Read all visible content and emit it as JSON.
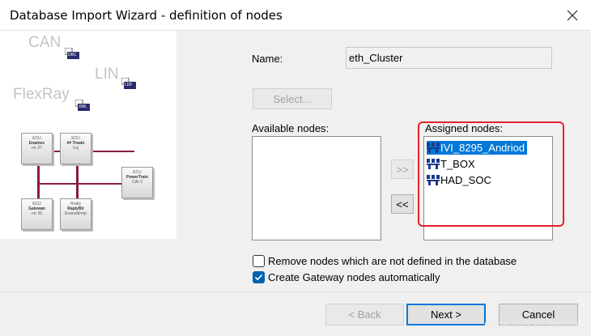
{
  "window": {
    "title": "Database Import Wizard - definition of nodes"
  },
  "illustration": {
    "bus_labels": [
      "CAN",
      "LIN",
      "FlexRay"
    ],
    "file_badges": [
      "DBC",
      "LDF",
      "XML"
    ],
    "ecus": [
      {
        "small": "ECU",
        "name": "Enaines",
        "sub": "nrr 27"
      },
      {
        "small": "ECU",
        "name": "## Treatn",
        "sub": "Irsj"
      },
      {
        "small": "ECU",
        "name": "Gatewan",
        "sub": "nrr 26"
      },
      {
        "small": "Rratly",
        "name": "RaplyBlr",
        "sub": "Enaneblrmp"
      },
      {
        "small": "ECU",
        "name": "PowerTrain",
        "sub": "CAr 2"
      }
    ],
    "wire_color": "#8b1a44"
  },
  "form": {
    "name_label": "Name:",
    "name_value": "eth_Cluster",
    "select_button": "Select...",
    "available_label": "Available nodes:",
    "assigned_label": "Assigned nodes:",
    "add_button": ">>",
    "remove_button": "<<",
    "available_nodes": [],
    "assigned_nodes": [
      {
        "label": "IVI_8295_Andriod",
        "selected": true
      },
      {
        "label": "T_BOX",
        "selected": false
      },
      {
        "label": "HAD_SOC",
        "selected": false
      }
    ],
    "remove_undefined_label": "Remove nodes which are not defined in the database",
    "remove_undefined_checked": false,
    "create_gateway_label": "Create Gateway nodes automatically",
    "create_gateway_checked": true
  },
  "footer": {
    "back_button": "< Back",
    "next_button": "Next >",
    "cancel_button": "Cancel"
  },
  "watermark": "CSDN @道法自然0402",
  "colors": {
    "accent": "#0078d7",
    "highlight": "#e8202a"
  }
}
